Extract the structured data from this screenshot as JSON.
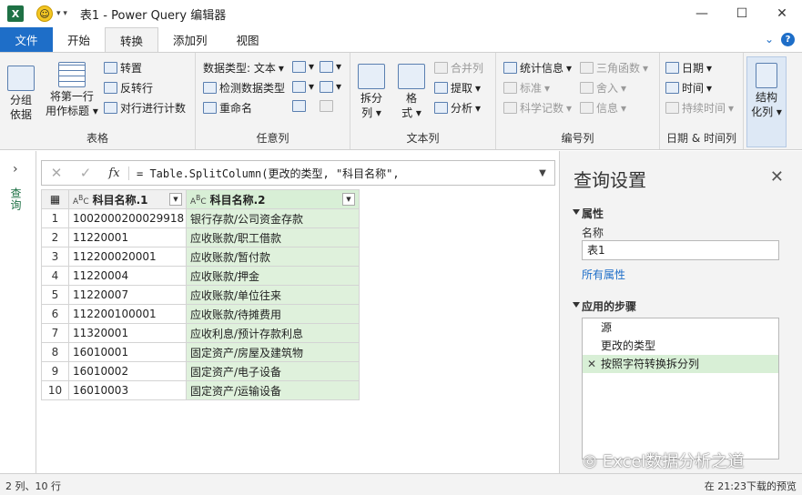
{
  "titlebar": {
    "app_icon": "X",
    "title": "表1 - Power Query 编辑器",
    "minimize": "—",
    "maximize": "☐",
    "close": "✕"
  },
  "tabs": [
    "文件",
    "开始",
    "转换",
    "添加列",
    "视图"
  ],
  "active_tab": "转换",
  "help": {
    "down": "⌄",
    "q": "?"
  },
  "ribbon": {
    "table": {
      "label": "表格",
      "group_by": [
        "分组",
        "依据"
      ],
      "use_first_row": [
        "将第一行",
        "用作标题"
      ],
      "transpose": "转置",
      "reverse_rows": "反转行",
      "count_rows": "对行进行计数"
    },
    "any_column": {
      "label": "任意列",
      "data_type": "数据类型: 文本",
      "detect_type": "检测数据类型",
      "rename": "重命名"
    },
    "text_column": {
      "label": "文本列",
      "split": [
        "拆分",
        "列"
      ],
      "format": [
        "格",
        "式"
      ],
      "merge": "合并列",
      "extract": "提取",
      "parse": "分析"
    },
    "number_column": {
      "label": "编号列",
      "statistics": "统计信息",
      "standard": "标准",
      "scientific": "科学记数",
      "trig": "三角函数",
      "rounding": "舍入",
      "info": "信息"
    },
    "datetime": {
      "label": "日期 & 时间列",
      "date": "日期",
      "time": "时间",
      "duration": "持续时间"
    },
    "structured": {
      "label": [
        "结构",
        "化列"
      ]
    }
  },
  "leftpane": {
    "label": "查询"
  },
  "formula": {
    "text": "= Table.SplitColumn(更改的类型, \"科目名称\","
  },
  "table": {
    "columns": [
      "科目名称.1",
      "科目名称.2"
    ],
    "rows": [
      [
        "1",
        "1002000200029918",
        "银行存款/公司资金存款"
      ],
      [
        "2",
        "11220001",
        "应收账款/职工借款"
      ],
      [
        "3",
        "112200020001",
        "应收账款/暂付款"
      ],
      [
        "4",
        "11220004",
        "应收账款/押金"
      ],
      [
        "5",
        "11220007",
        "应收账款/单位往来"
      ],
      [
        "6",
        "112200100001",
        "应收账款/待摊费用"
      ],
      [
        "7",
        "11320001",
        "应收利息/预计存款利息"
      ],
      [
        "8",
        "16010001",
        "固定资产/房屋及建筑物"
      ],
      [
        "9",
        "16010002",
        "固定资产/电子设备"
      ],
      [
        "10",
        "16010003",
        "固定资产/运输设备"
      ]
    ]
  },
  "query_settings": {
    "title": "查询设置",
    "properties": "属性",
    "name_label": "名称",
    "name_value": "表1",
    "all_properties": "所有属性",
    "applied_steps": "应用的步骤",
    "steps": [
      "源",
      "更改的类型",
      "按照字符转换拆分列"
    ]
  },
  "watermark": "Excel数据分析之道",
  "status": {
    "left": "2 列、10 行",
    "right": "在 21:23下载的预览"
  }
}
